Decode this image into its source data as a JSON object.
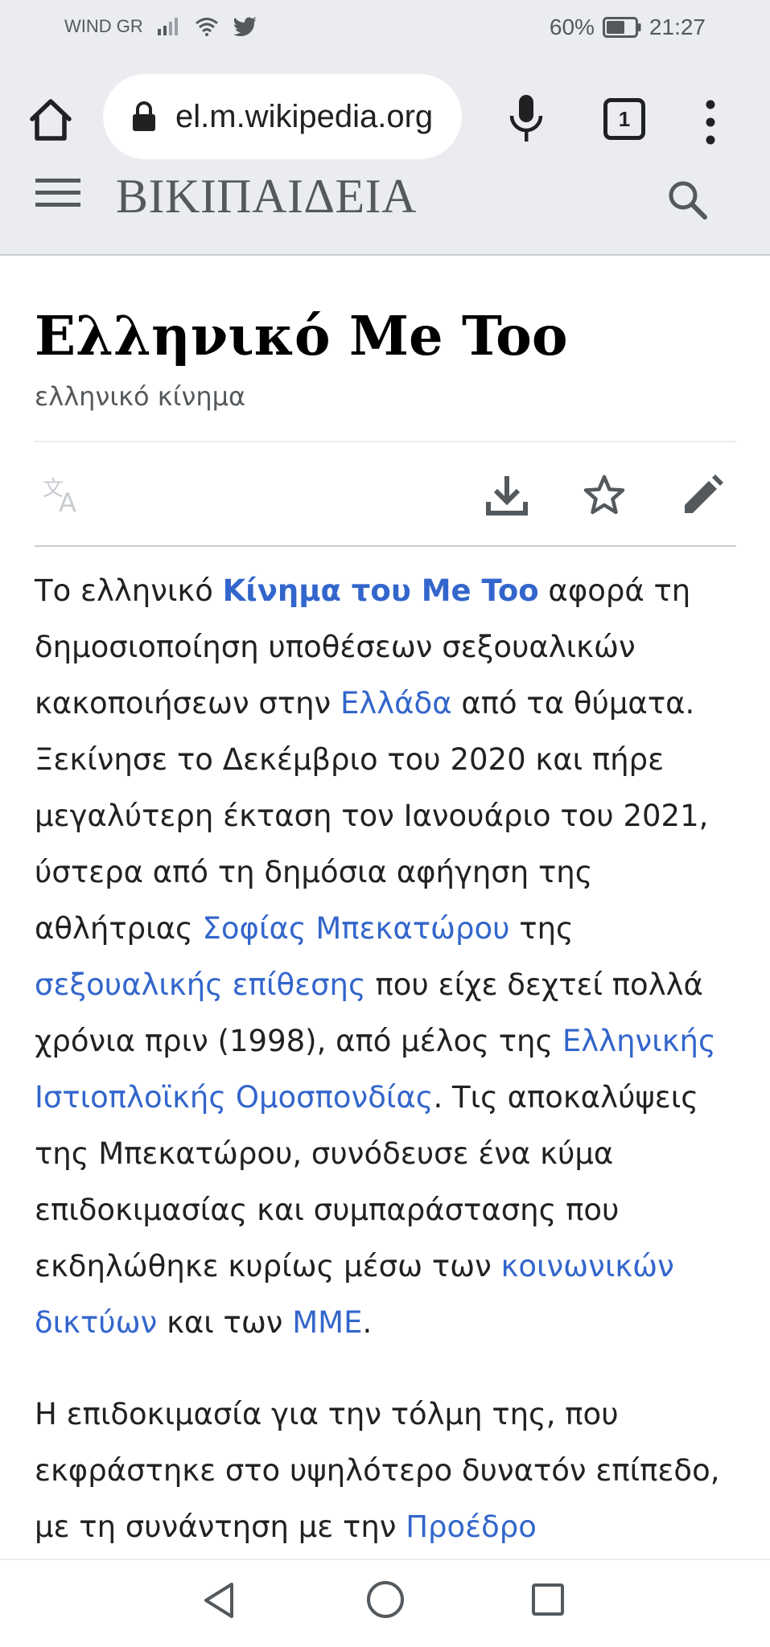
{
  "status_bar": {
    "carrier": "WIND GR",
    "battery": "60%",
    "time": "21:27"
  },
  "browser": {
    "url": "el.m.wikipedia.org",
    "tab_count": "1"
  },
  "wiki": {
    "logo": "ΒΙΚΙΠΑΙΔΕΙΑ"
  },
  "article": {
    "title": "Ελληνικό Me Too",
    "subtitle": "ελληνικό κίνημα",
    "p1": {
      "t1": "Το ελληνικό ",
      "l1": "Κίνημα του Me Too",
      "t2": " αφορά τη δημοσιοποίηση υποθέσεων σεξουαλικών κακοποιήσεων στην ",
      "l2": "Ελλάδα",
      "t3": " από τα θύματα. Ξεκίνησε το Δεκέμβριο του 2020 και πήρε μεγαλύτερη έκταση τον Ιανουάριο του 2021, ύστερα από τη δημόσια αφήγηση της αθλήτριας ",
      "l3": "Σοφίας Μπεκατώρου",
      "t4": " της ",
      "l4": "σεξουαλικής επίθεσης",
      "t5": " που είχε δεχτεί πολλά χρόνια πριν (1998), από μέλος της ",
      "l5": "Ελληνικής Ιστιοπλοϊκής Ομοσπονδίας",
      "t6": ". Τις αποκαλύψεις της Μπεκατώρου, συνόδευσε ένα κύμα επιδοκιμασίας και συμπαράστασης που εκδηλώθηκε κυρίως μέσω των ",
      "l6": "κοινωνικών δικτύων",
      "t7": " και των ",
      "l7": "ΜΜΕ",
      "t8": "."
    },
    "p2": {
      "t1": "Η επιδοκιμασία για την τόλμη της, που εκφράστηκε στο υψηλότερο δυνατόν επίπεδο, με τη συνάντηση με την ",
      "l1": "Προέδρο",
      "t2": ""
    }
  },
  "colors": {
    "link": "#3366cc",
    "chrome_bg": "#eaecf0",
    "text": "#202122"
  }
}
